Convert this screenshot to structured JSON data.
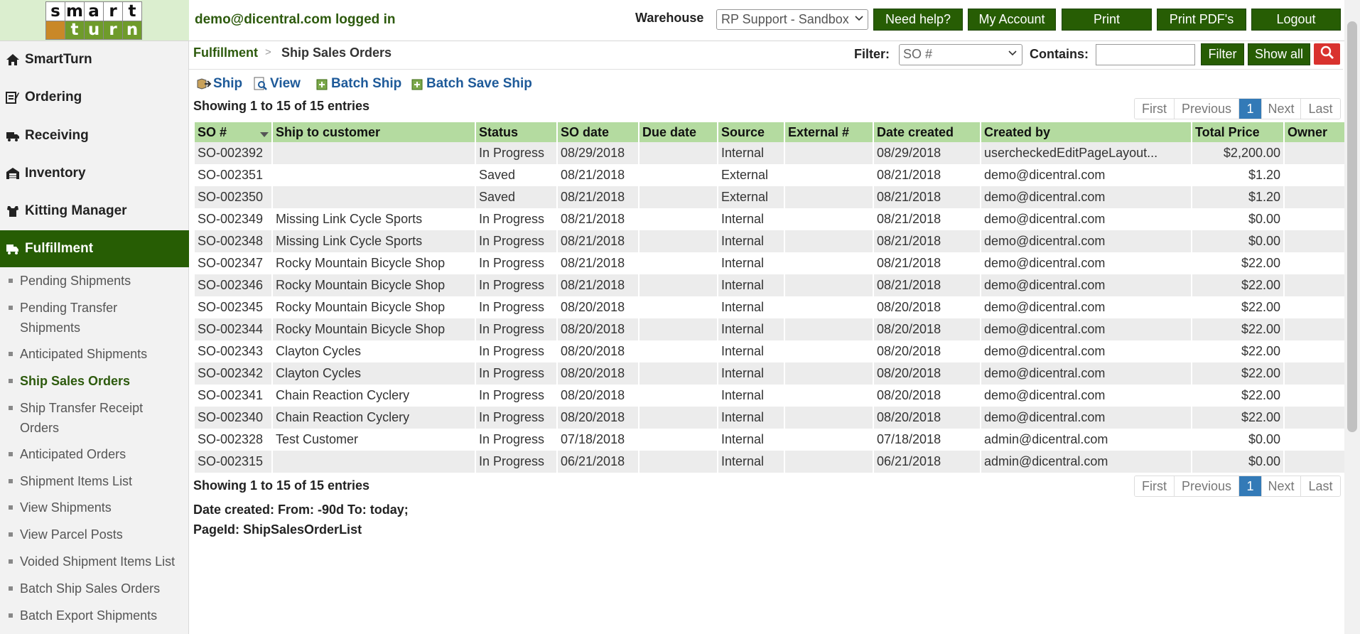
{
  "header": {
    "logo_top": [
      "s",
      "m",
      "a",
      "r",
      "t"
    ],
    "logo_bottom": [
      "t",
      "u",
      "r",
      "n"
    ],
    "user_status": "demo@dicentral.com logged in",
    "warehouse_label": "Warehouse",
    "warehouse_value": "RP Support - Sandbox",
    "buttons": {
      "help": "Need help?",
      "account": "My Account",
      "print": "Print",
      "print_pdf": "Print PDF's",
      "logout": "Logout"
    }
  },
  "sidebar": {
    "nav": [
      {
        "label": "SmartTurn",
        "icon": "home-icon"
      },
      {
        "label": "Ordering",
        "icon": "ordering-icon"
      },
      {
        "label": "Receiving",
        "icon": "receiving-icon"
      },
      {
        "label": "Inventory",
        "icon": "inventory-icon"
      },
      {
        "label": "Kitting Manager",
        "icon": "kitting-icon"
      },
      {
        "label": "Fulfillment",
        "icon": "fulfillment-icon",
        "active": true
      }
    ],
    "sub_items": [
      "Pending Shipments",
      "Pending Transfer Shipments",
      "Anticipated Shipments",
      "Ship Sales Orders",
      "Ship Transfer Receipt Orders",
      "Anticipated Orders",
      "Shipment Items List",
      "View Shipments",
      "View Parcel Posts",
      "Voided Shipment Items List",
      "Batch Ship Sales Orders",
      "Batch Export Shipments"
    ],
    "active_sub": "Ship Sales Orders"
  },
  "breadcrumb": {
    "root": "Fulfillment",
    "separator": ">",
    "current": "Ship Sales Orders"
  },
  "filter": {
    "label": "Filter:",
    "selected": "SO #",
    "contains_label": "Contains:",
    "contains_value": "",
    "filter_button": "Filter",
    "show_all_button": "Show all"
  },
  "toolbar": {
    "ship": "Ship",
    "view": "View",
    "batch_ship": "Batch Ship",
    "batch_save_ship": "Batch Save Ship"
  },
  "showing_text": "Showing 1 to 15 of 15 entries",
  "pager": {
    "first": "First",
    "previous": "Previous",
    "current": "1",
    "next": "Next",
    "last": "Last"
  },
  "table": {
    "columns": [
      "SO #",
      "Ship to customer",
      "Status",
      "SO date",
      "Due date",
      "Source",
      "External #",
      "Date created",
      "Created by",
      "Total Price",
      "Owner"
    ],
    "rows": [
      [
        "SO-002392",
        "",
        "In Progress",
        "08/29/2018",
        "",
        "Internal",
        "",
        "08/29/2018",
        "usercheckedEditPageLayout...",
        "$2,200.00",
        ""
      ],
      [
        "SO-002351",
        "",
        "Saved",
        "08/21/2018",
        "",
        "External",
        "",
        "08/21/2018",
        "demo@dicentral.com",
        "$1.20",
        ""
      ],
      [
        "SO-002350",
        "",
        "Saved",
        "08/21/2018",
        "",
        "External",
        "",
        "08/21/2018",
        "demo@dicentral.com",
        "$1.20",
        ""
      ],
      [
        "SO-002349",
        "Missing Link Cycle Sports",
        "In Progress",
        "08/21/2018",
        "",
        "Internal",
        "",
        "08/21/2018",
        "demo@dicentral.com",
        "$0.00",
        ""
      ],
      [
        "SO-002348",
        "Missing Link Cycle Sports",
        "In Progress",
        "08/21/2018",
        "",
        "Internal",
        "",
        "08/21/2018",
        "demo@dicentral.com",
        "$0.00",
        ""
      ],
      [
        "SO-002347",
        "Rocky Mountain Bicycle Shop",
        "In Progress",
        "08/21/2018",
        "",
        "Internal",
        "",
        "08/21/2018",
        "demo@dicentral.com",
        "$22.00",
        ""
      ],
      [
        "SO-002346",
        "Rocky Mountain Bicycle Shop",
        "In Progress",
        "08/21/2018",
        "",
        "Internal",
        "",
        "08/21/2018",
        "demo@dicentral.com",
        "$22.00",
        ""
      ],
      [
        "SO-002345",
        "Rocky Mountain Bicycle Shop",
        "In Progress",
        "08/20/2018",
        "",
        "Internal",
        "",
        "08/20/2018",
        "demo@dicentral.com",
        "$22.00",
        ""
      ],
      [
        "SO-002344",
        "Rocky Mountain Bicycle Shop",
        "In Progress",
        "08/20/2018",
        "",
        "Internal",
        "",
        "08/20/2018",
        "demo@dicentral.com",
        "$22.00",
        ""
      ],
      [
        "SO-002343",
        "Clayton Cycles",
        "In Progress",
        "08/20/2018",
        "",
        "Internal",
        "",
        "08/20/2018",
        "demo@dicentral.com",
        "$22.00",
        ""
      ],
      [
        "SO-002342",
        "Clayton Cycles",
        "In Progress",
        "08/20/2018",
        "",
        "Internal",
        "",
        "08/20/2018",
        "demo@dicentral.com",
        "$22.00",
        ""
      ],
      [
        "SO-002341",
        "Chain Reaction Cyclery",
        "In Progress",
        "08/20/2018",
        "",
        "Internal",
        "",
        "08/20/2018",
        "demo@dicentral.com",
        "$22.00",
        ""
      ],
      [
        "SO-002340",
        "Chain Reaction Cyclery",
        "In Progress",
        "08/20/2018",
        "",
        "Internal",
        "",
        "08/20/2018",
        "demo@dicentral.com",
        "$22.00",
        ""
      ],
      [
        "SO-002328",
        "Test Customer",
        "In Progress",
        "07/18/2018",
        "",
        "Internal",
        "",
        "07/18/2018",
        "admin@dicentral.com",
        "$0.00",
        ""
      ],
      [
        "SO-002315",
        "",
        "In Progress",
        "06/21/2018",
        "",
        "Internal",
        "",
        "06/21/2018",
        "admin@dicentral.com",
        "$0.00",
        ""
      ]
    ]
  },
  "footer": {
    "date_note": "Date created: From: -90d To: today;",
    "page_id": "PageId: ShipSalesOrderList"
  },
  "colors": {
    "brand_green": "#275d04",
    "header_green": "#b4dba0",
    "link_blue": "#1e5a99",
    "pager_active": "#337ab7",
    "search_red": "#d9322e"
  }
}
